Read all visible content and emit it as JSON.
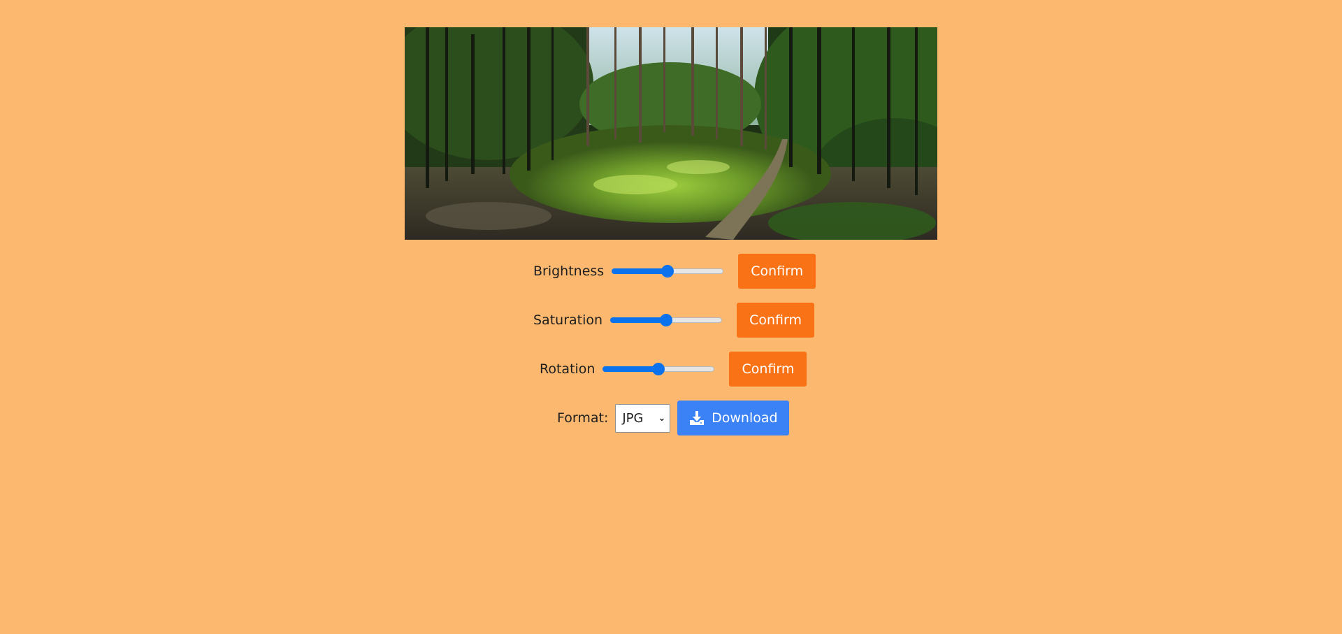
{
  "image": {
    "alt": "Forest clearing panorama",
    "icon": "photo"
  },
  "controls": [
    {
      "label": "Brightness",
      "value": 0.5,
      "button": "Confirm"
    },
    {
      "label": "Saturation",
      "value": 0.5,
      "button": "Confirm"
    },
    {
      "label": "Rotation",
      "value": 0.5,
      "button": "Confirm"
    }
  ],
  "export": {
    "format_label": "Format:",
    "format_selected": "JPG",
    "download_label": "Download",
    "download_icon": "download-icon"
  },
  "colors": {
    "background": "#FDB870",
    "confirm_button": "#F97316",
    "download_button": "#3B82F6",
    "slider_accent": "#0B72EE"
  }
}
